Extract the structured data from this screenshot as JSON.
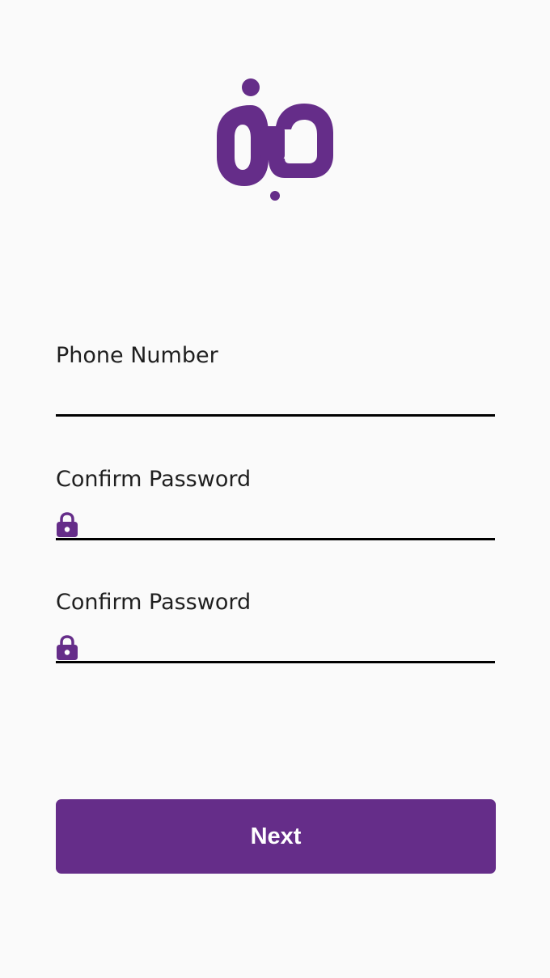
{
  "brand": {
    "logo_icon": "brand-logo-icon",
    "primary_color": "#652d89"
  },
  "form": {
    "phone": {
      "label": "Phone Number",
      "value": "",
      "placeholder": ""
    },
    "password_1": {
      "label": "Confirm Password",
      "value": "",
      "placeholder": "",
      "icon": "lock-icon"
    },
    "password_2": {
      "label": "Confirm Password",
      "value": "",
      "placeholder": "",
      "icon": "lock-icon"
    }
  },
  "actions": {
    "next_label": "Next"
  }
}
